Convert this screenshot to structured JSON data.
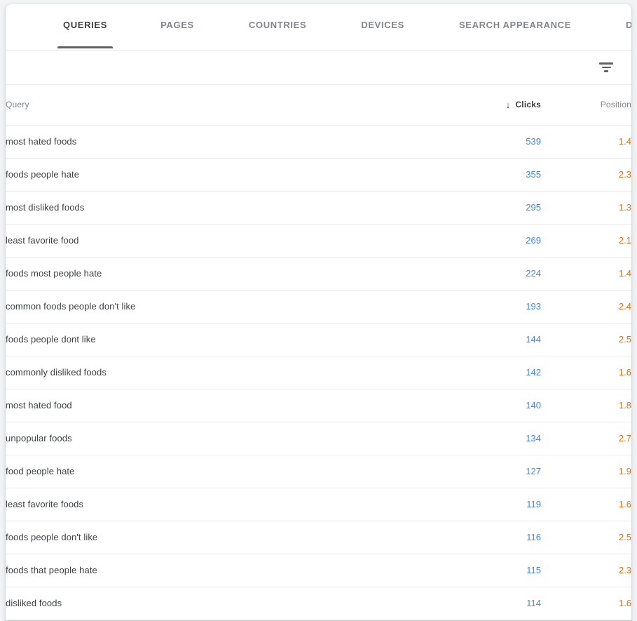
{
  "tabs": [
    {
      "label": "QUERIES",
      "active": true
    },
    {
      "label": "PAGES",
      "active": false
    },
    {
      "label": "COUNTRIES",
      "active": false
    },
    {
      "label": "DEVICES",
      "active": false
    },
    {
      "label": "SEARCH APPEARANCE",
      "active": false
    },
    {
      "label": "DATES",
      "active": false
    }
  ],
  "toolbar": {
    "filter_icon": "filter-list-icon"
  },
  "table": {
    "columns": {
      "query": "Query",
      "clicks": "Clicks",
      "position": "Position"
    },
    "sort": {
      "column": "Clicks",
      "direction": "descending",
      "arrow_glyph": "↓"
    },
    "rows": [
      {
        "query": "most hated foods",
        "clicks": "539",
        "position": "1.4"
      },
      {
        "query": "foods people hate",
        "clicks": "355",
        "position": "2.3"
      },
      {
        "query": "most disliked foods",
        "clicks": "295",
        "position": "1.3"
      },
      {
        "query": "least favorite food",
        "clicks": "269",
        "position": "2.1"
      },
      {
        "query": "foods most people hate",
        "clicks": "224",
        "position": "1.4"
      },
      {
        "query": "common foods people don't like",
        "clicks": "193",
        "position": "2.4"
      },
      {
        "query": "foods people dont like",
        "clicks": "144",
        "position": "2.5"
      },
      {
        "query": "commonly disliked foods",
        "clicks": "142",
        "position": "1.6"
      },
      {
        "query": "most hated food",
        "clicks": "140",
        "position": "1.8"
      },
      {
        "query": "unpopular foods",
        "clicks": "134",
        "position": "2.7"
      },
      {
        "query": "food people hate",
        "clicks": "127",
        "position": "1.9"
      },
      {
        "query": "least favorite foods",
        "clicks": "119",
        "position": "1.6"
      },
      {
        "query": "foods people don't like",
        "clicks": "116",
        "position": "2.5"
      },
      {
        "query": "foods that people hate",
        "clicks": "115",
        "position": "2.3"
      },
      {
        "query": "disliked foods",
        "clicks": "114",
        "position": "1.6"
      }
    ]
  },
  "colors": {
    "clicks": "#4285f4",
    "position": "#e8710a",
    "active_tab": "#3c4043",
    "inactive_tab": "#80868b",
    "row_text": "#3c4043",
    "divider": "#e8eaed",
    "page_background": "#f1f3f4"
  }
}
